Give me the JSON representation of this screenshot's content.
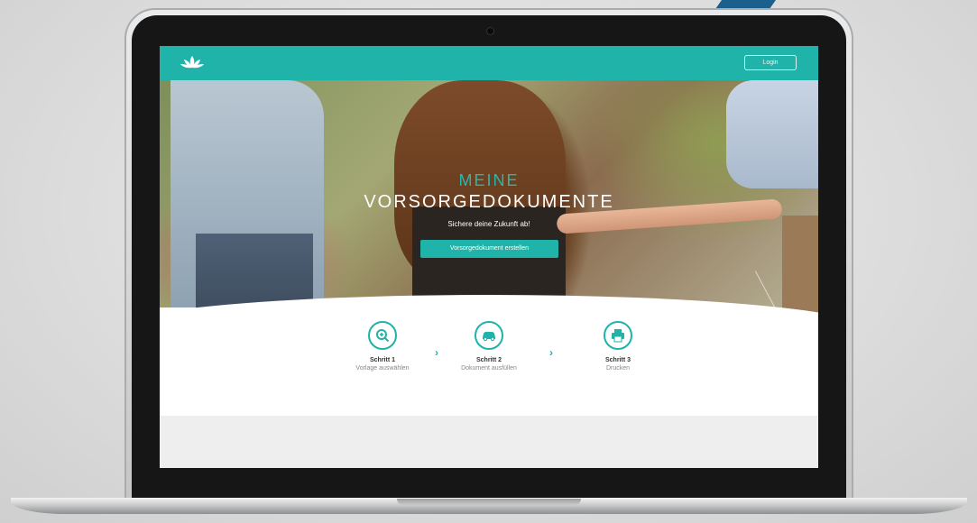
{
  "header": {
    "logo_icon": "lotus-icon",
    "login_label": "Login"
  },
  "hero": {
    "title_line1": "MEINE",
    "title_line2": "VORSORGEDOKUMENTE",
    "subtitle": "Sichere deine Zukunft ab!",
    "cta_label": "Vorsorgedokument erstellen"
  },
  "steps": [
    {
      "icon": "magnifier-icon",
      "title": "Schritt 1",
      "description": "Vorlage auswählen"
    },
    {
      "icon": "car-icon",
      "title": "Schritt 2",
      "description": "Dokument ausfüllen"
    },
    {
      "icon": "printer-icon",
      "title": "Schritt 3",
      "description": "Drucken"
    }
  ],
  "colors": {
    "accent": "#1fb3aa",
    "stripe": "#1b5f8c"
  }
}
